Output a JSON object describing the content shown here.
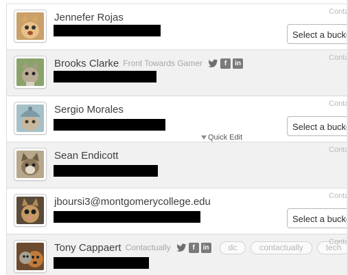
{
  "contacts": [
    {
      "name": "Jennefer Rojas",
      "subtitle": "",
      "contact_label": "Conta",
      "bucket_label": "Select a bucket",
      "avatar": "cat-kitten-icon"
    },
    {
      "name": "Brooks Clarke",
      "subtitle": "Front Towards Gamer",
      "contact_label": "Conta",
      "socials": [
        "twitter-icon",
        "facebook-icon",
        "linkedin-icon"
      ],
      "avatar": "cat-kitten-icon"
    },
    {
      "name": "Sergio Morales",
      "subtitle": "",
      "contact_label": "Conta",
      "bucket_label": "Select a bucket",
      "avatar": "cat-kitten-icon"
    },
    {
      "name": "Sean Endicott",
      "subtitle": "",
      "contact_label": "Conta",
      "avatar": "cat-kitten-icon"
    },
    {
      "name": "jboursi3@montgomerycollege.edu",
      "subtitle": "",
      "contact_label": "Conta",
      "bucket_label": "Select a bucket",
      "avatar": "cat-kitten-icon"
    },
    {
      "name": "Tony Cappaert",
      "subtitle": "Contactually",
      "contact_label": "Conta",
      "socials": [
        "twitter-icon",
        "facebook-icon",
        "linkedin-icon"
      ],
      "tags": [
        "dc",
        "contactually",
        "tech"
      ],
      "avatar": "cat-dog-icon"
    }
  ],
  "quick_edit_label": "Quick Edit",
  "social_glyphs": {
    "facebook": "f",
    "linkedin": "in"
  }
}
